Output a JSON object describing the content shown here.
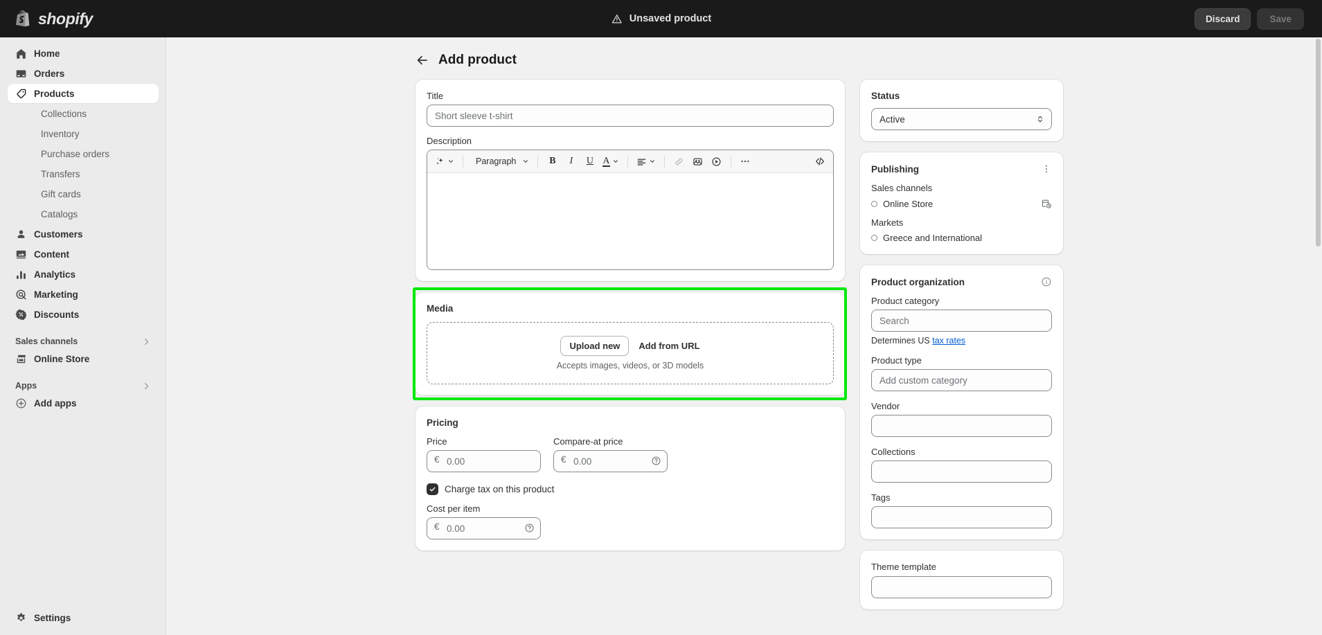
{
  "topbar": {
    "brand": "shopify",
    "logo_icon": "shopify-bag-icon",
    "unsaved_icon": "warning-triangle-icon",
    "unsaved_label": "Unsaved product",
    "discard_label": "Discard",
    "save_label": "Save"
  },
  "sidebar": {
    "items": [
      {
        "label": "Home",
        "icon": "home-icon"
      },
      {
        "label": "Orders",
        "icon": "orders-inbox-icon"
      },
      {
        "label": "Products",
        "icon": "product-tag-icon",
        "active": true
      }
    ],
    "product_subitems": [
      {
        "label": "Collections"
      },
      {
        "label": "Inventory"
      },
      {
        "label": "Purchase orders"
      },
      {
        "label": "Transfers"
      },
      {
        "label": "Gift cards"
      },
      {
        "label": "Catalogs"
      }
    ],
    "items2": [
      {
        "label": "Customers",
        "icon": "customer-person-icon"
      },
      {
        "label": "Content",
        "icon": "content-image-icon"
      },
      {
        "label": "Analytics",
        "icon": "analytics-bars-icon"
      },
      {
        "label": "Marketing",
        "icon": "marketing-target-icon"
      },
      {
        "label": "Discounts",
        "icon": "discount-badge-icon"
      }
    ],
    "sales_channels_section": "Sales channels",
    "online_store": "Online Store",
    "apps_section": "Apps",
    "add_apps": "Add apps",
    "settings": "Settings"
  },
  "page": {
    "back_icon": "back-arrow-icon",
    "title": "Add product"
  },
  "product_form": {
    "title_label": "Title",
    "title_value": "",
    "title_placeholder": "Short sleeve t-shirt",
    "description_label": "Description",
    "description_value": "",
    "toolbar": {
      "ai_icon": "sparkle-ai-icon",
      "paragraph_label": "Paragraph",
      "bold_label": "B",
      "italic_label": "I",
      "underline_label": "U",
      "text_color_label": "A",
      "align_icon": "align-left-icon",
      "link_icon": "link-icon",
      "image_icon": "insert-image-icon",
      "video_icon": "insert-video-icon",
      "more_icon": "more-horizontal-icon",
      "code_icon": "code-brackets-icon"
    }
  },
  "media": {
    "title": "Media",
    "upload_label": "Upload new",
    "add_url_label": "Add from URL",
    "hint": "Accepts images, videos, or 3D models",
    "highlight_color": "#00e90b"
  },
  "pricing": {
    "title": "Pricing",
    "price_label": "Price",
    "price_value": "",
    "price_placeholder": "0.00",
    "currency_symbol": "€",
    "compare_label": "Compare-at price",
    "compare_value": "",
    "compare_placeholder": "0.00",
    "charge_tax_label": "Charge tax on this product",
    "charge_tax_checked": true,
    "cost_label": "Cost per item",
    "cost_value": "",
    "cost_placeholder": "0.00",
    "help_icon": "question-circle-icon"
  },
  "status_card": {
    "title": "Status",
    "value": "Active",
    "caret_icon": "select-updown-icon"
  },
  "publishing": {
    "title": "Publishing",
    "menu_icon": "more-vertical-icon",
    "sales_channels_label": "Sales channels",
    "online_store": "Online Store",
    "schedule_icon": "calendar-clock-icon",
    "markets_label": "Markets",
    "market_value": "Greece and International"
  },
  "organization": {
    "title": "Product organization",
    "info_icon": "info-circle-icon",
    "category_label": "Product category",
    "category_value": "",
    "category_placeholder": "Search",
    "determines_prefix": "Determines US ",
    "tax_rates_link": "tax rates",
    "type_label": "Product type",
    "type_value": "",
    "type_placeholder": "Add custom category",
    "vendor_label": "Vendor",
    "vendor_value": "",
    "collections_label": "Collections",
    "collections_value": "",
    "tags_label": "Tags",
    "tags_value": ""
  },
  "theme": {
    "title": "Theme template"
  }
}
